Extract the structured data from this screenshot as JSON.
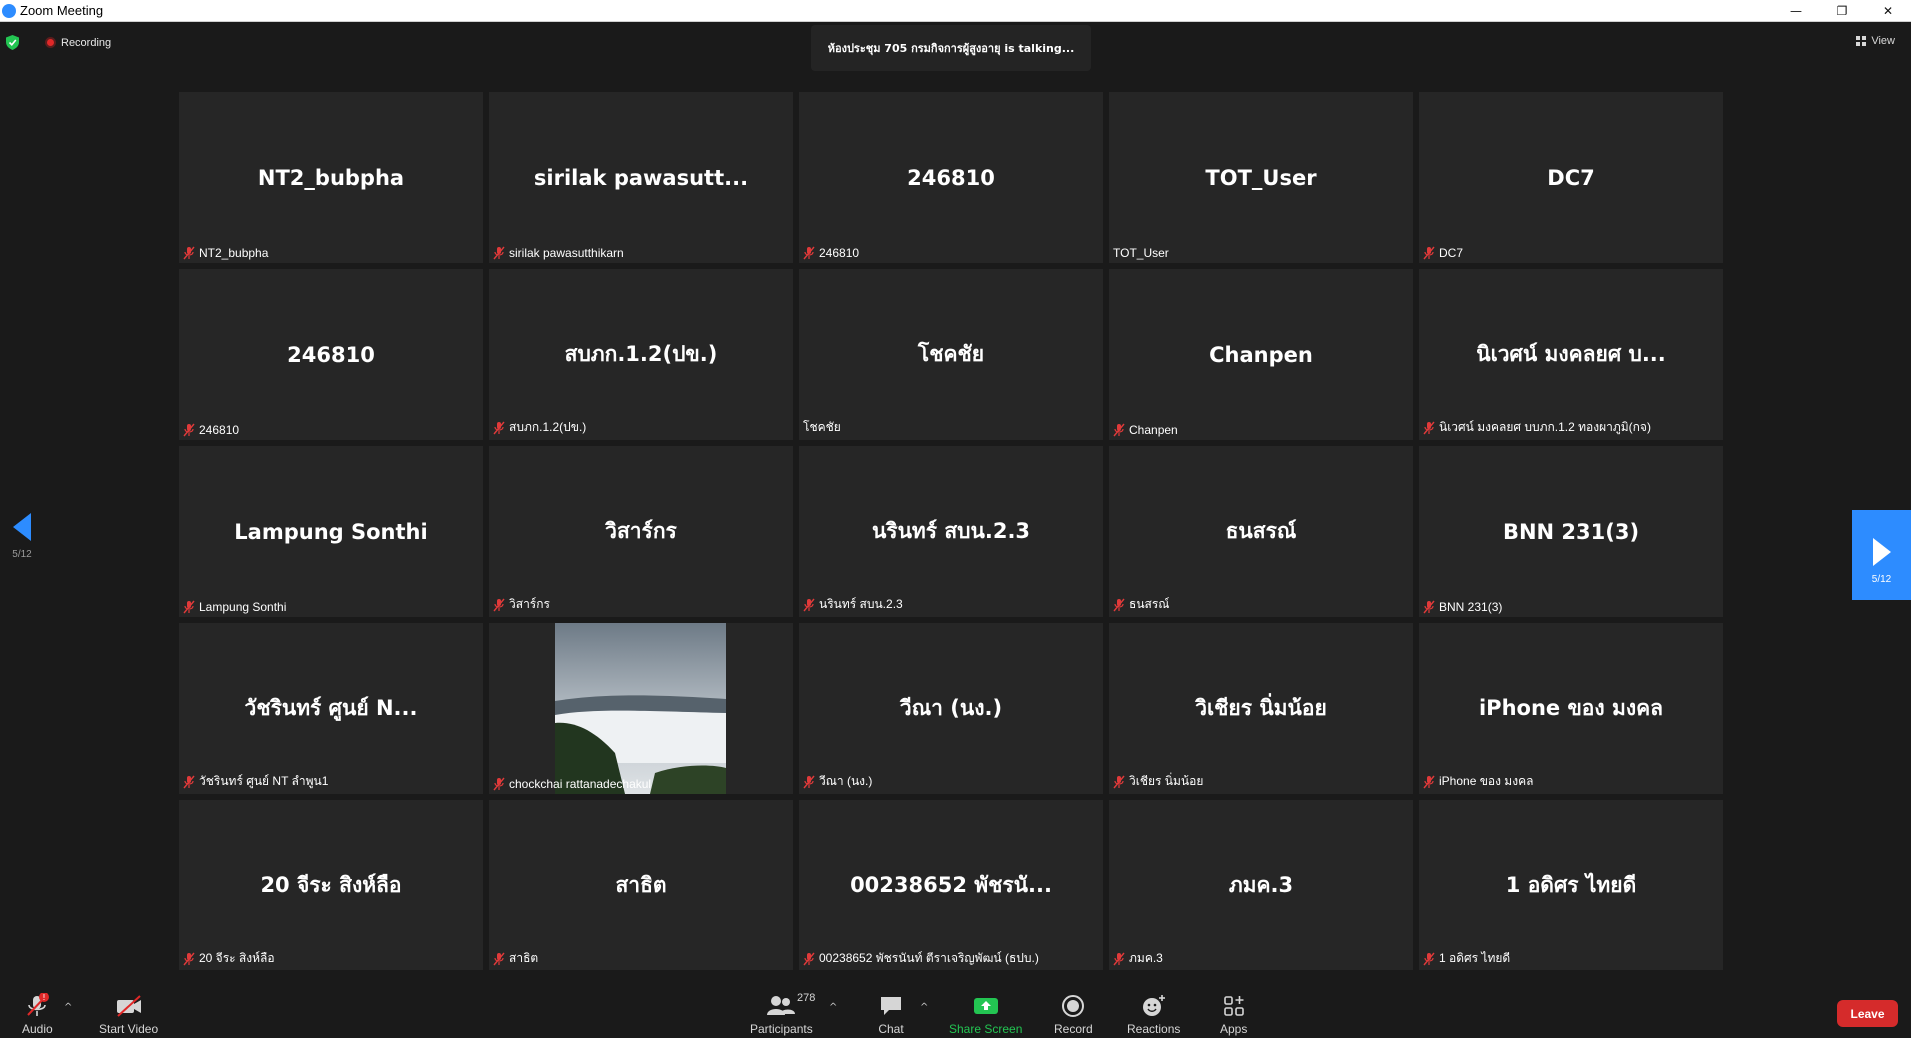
{
  "window": {
    "title": "Zoom Meeting",
    "minimize": "—",
    "restore": "❐",
    "close": "✕"
  },
  "status": {
    "recording_label": "Recording",
    "talking_text": "ห้องประชุม 705 กรมกิจการผู้สูงอายุ is talking...",
    "view_label": "View"
  },
  "tiles": [
    {
      "big": "NT2_bubpha",
      "name": "NT2_bubpha",
      "muted": true
    },
    {
      "big": "sirilak pawasutt...",
      "name": "sirilak pawasutthikarn",
      "muted": true
    },
    {
      "big": "246810",
      "name": "246810",
      "muted": true
    },
    {
      "big": "TOT_User",
      "name": "TOT_User",
      "muted": false
    },
    {
      "big": "DC7",
      "name": "DC7",
      "muted": true
    },
    {
      "big": "246810",
      "name": "246810",
      "muted": true
    },
    {
      "big": "สบภก.1.2(ปข.)",
      "name": "สบภก.1.2(ปข.)",
      "muted": true
    },
    {
      "big": "โชคชัย",
      "name": "โชคชัย",
      "muted": false
    },
    {
      "big": "Chanpen",
      "name": "Chanpen",
      "muted": true
    },
    {
      "big": "นิเวศน์ มงคลยศ บ...",
      "name": "นิเวศน์ มงคลยศ บบภก.1.2 ทองผาภูมิ(กจ)",
      "muted": true
    },
    {
      "big": "Lampung Sonthi",
      "name": "Lampung Sonthi",
      "muted": true
    },
    {
      "big": "วิสาร์กร",
      "name": "วิสาร์กร",
      "muted": true
    },
    {
      "big": "นรินทร์  สบน.2.3",
      "name": "นรินทร์  สบน.2.3",
      "muted": true
    },
    {
      "big": "ธนสรณ์",
      "name": "ธนสรณ์",
      "muted": true
    },
    {
      "big": "BNN 231(3)",
      "name": "BNN 231(3)",
      "muted": true
    },
    {
      "big": "วัชรินทร์   ศูนย์ N...",
      "name": "วัชรินทร์   ศูนย์ NT ลำพูน1",
      "muted": true
    },
    {
      "big": "",
      "name": "chockchai rattanadechakul",
      "muted": true,
      "photo": true
    },
    {
      "big": "วีณา (นง.)",
      "name": "วีณา (นง.)",
      "muted": true
    },
    {
      "big": "วิเชียร นิ่มน้อย",
      "name": "วิเชียร นิ่มน้อย",
      "muted": true
    },
    {
      "big": "iPhone ของ มงคล",
      "name": "iPhone ของ มงคล",
      "muted": true
    },
    {
      "big": "20 จีระ สิงห์ลือ",
      "name": "20 จีระ สิงห์ลือ",
      "muted": true
    },
    {
      "big": "สาธิต",
      "name": "สาธิต",
      "muted": true
    },
    {
      "big": "00238652 พัชรนั...",
      "name": "00238652 พัชรนันท์ ตีราเจริญพัฒน์ (ธปบ.)",
      "muted": true
    },
    {
      "big": "ภมค.3",
      "name": "ภมค.3",
      "muted": true
    },
    {
      "big": "1 อดิศร  ไทยดี",
      "name": "1 อดิศร  ไทยดี",
      "muted": true
    }
  ],
  "pagination": {
    "left": "5/12",
    "right": "5/12"
  },
  "toolbar": {
    "audio": "Audio",
    "start_video": "Start Video",
    "participants": "Participants",
    "participant_count": "278",
    "chat": "Chat",
    "share_screen": "Share Screen",
    "record": "Record",
    "reactions": "Reactions",
    "apps": "Apps",
    "leave": "Leave",
    "audio_alert": "!",
    "caret": "^"
  },
  "colors": {
    "accent": "#2d8cff",
    "leave": "#d52b2b",
    "share": "#23c552",
    "tile_bg": "#262626",
    "bg": "#1a1a1a"
  }
}
